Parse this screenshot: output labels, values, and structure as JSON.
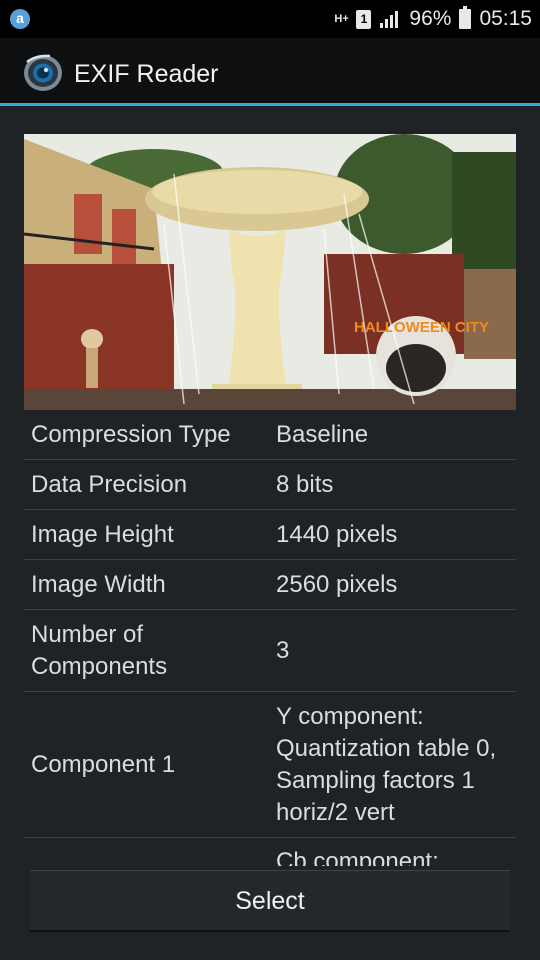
{
  "status_bar": {
    "app_icon": "a",
    "network": "H+",
    "sim": "1",
    "battery_percent": "96%",
    "time": "05:15"
  },
  "action_bar": {
    "title": "EXIF Reader",
    "logo_icon": "camera-lens-icon"
  },
  "photo": {
    "overlay_text": "HALLOWEEN CITY",
    "description_icon": "photo-thumbnail"
  },
  "exif": [
    {
      "label": "Compression Type",
      "value": "Baseline"
    },
    {
      "label": "Data Precision",
      "value": "8 bits"
    },
    {
      "label": "Image Height",
      "value": "1440 pixels"
    },
    {
      "label": "Image Width",
      "value": "2560 pixels"
    },
    {
      "label": "Number of Components",
      "value": "3"
    },
    {
      "label": "Component 1",
      "value": "Y component: Quantization table 0, Sampling factors 1 horiz/2 vert"
    },
    {
      "label": "",
      "value": "Cb component:"
    }
  ],
  "buttons": {
    "select": "Select"
  },
  "colors": {
    "accent": "#33a9d8",
    "background": "#1f2326",
    "action_bar": "#0d0f10"
  }
}
